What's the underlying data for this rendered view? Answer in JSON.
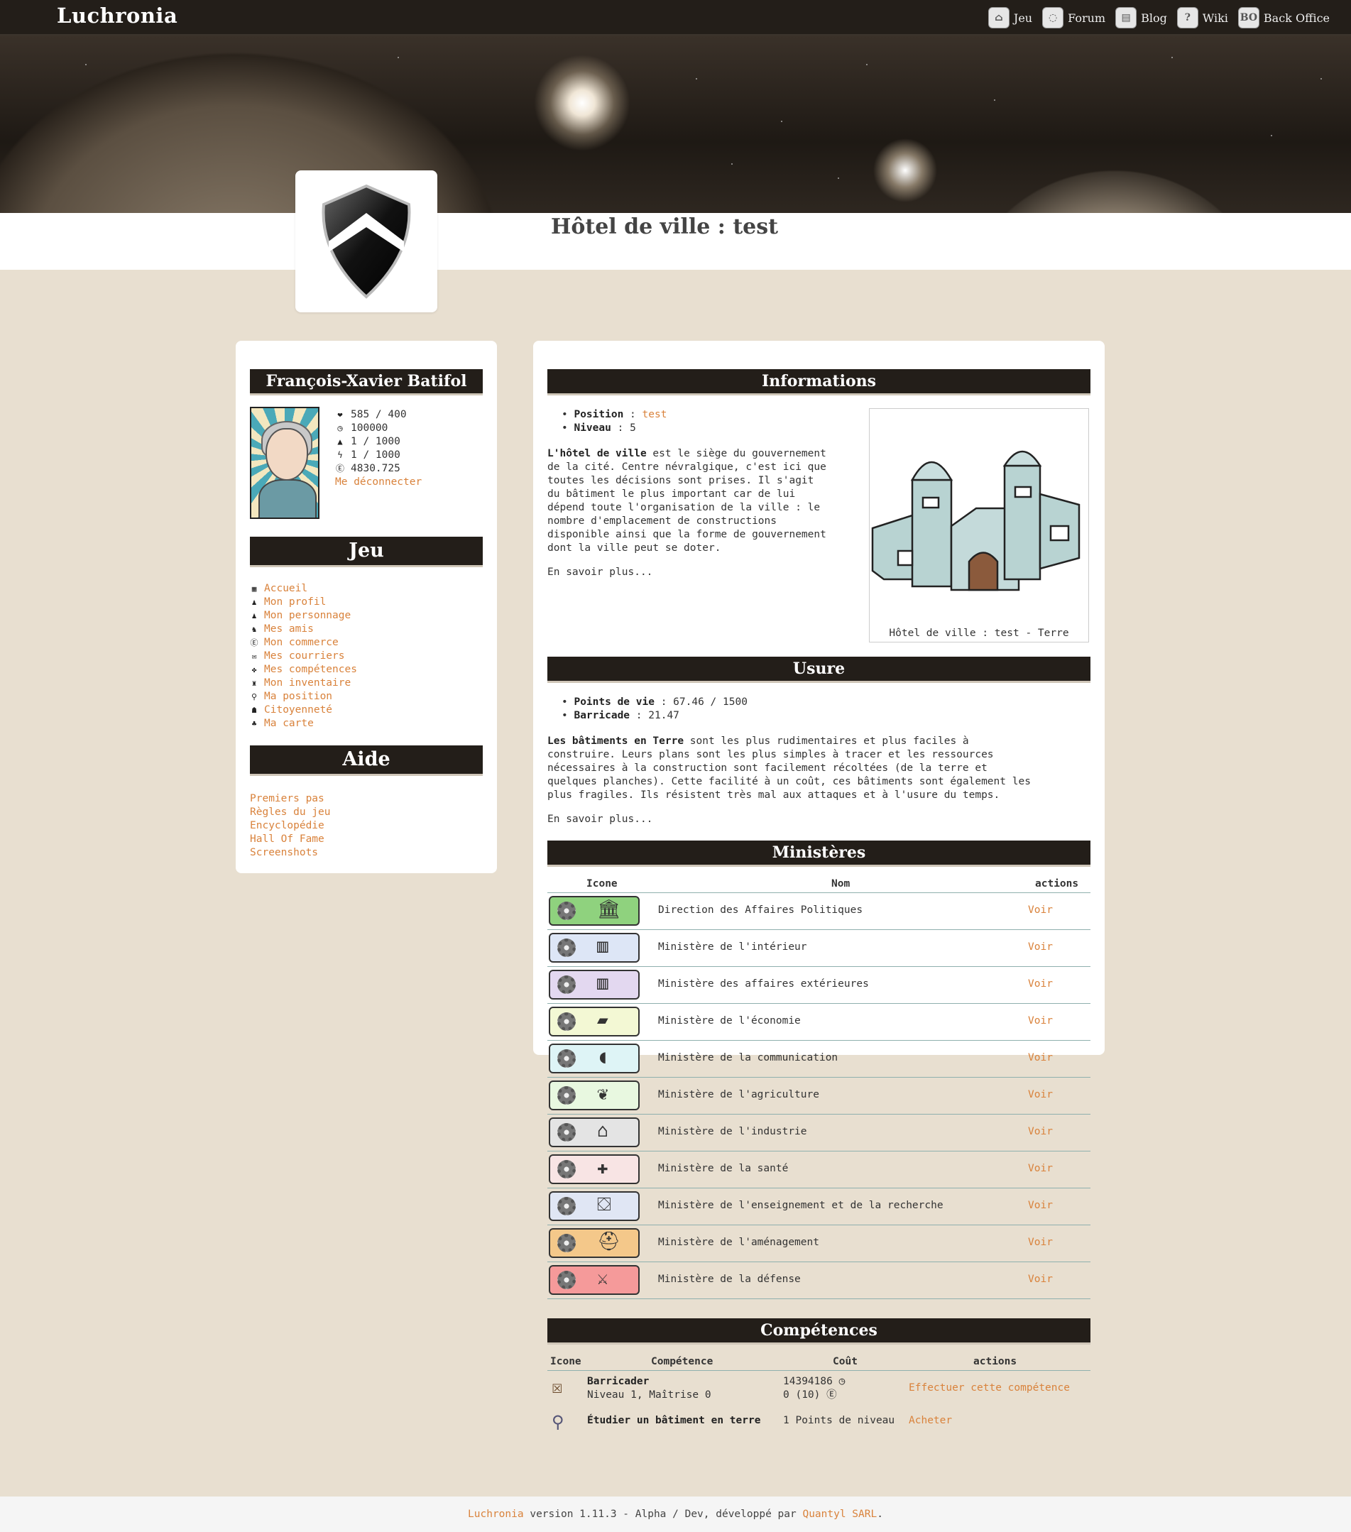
{
  "app": {
    "logo": "Luchronia",
    "nav": [
      {
        "label": "Jeu",
        "icon": "home-icon"
      },
      {
        "label": "Forum",
        "icon": "chat-bubble-icon"
      },
      {
        "label": "Blog",
        "icon": "book-icon"
      },
      {
        "label": "Wiki",
        "icon": "help-icon"
      },
      {
        "label": "Back Office",
        "icon": "bo-icon",
        "glyph": "BO"
      }
    ]
  },
  "page": {
    "title": "Hôtel de ville : test",
    "emblem_icon": "shield-chevron-icon"
  },
  "character": {
    "name": "François-Xavier Batifol",
    "stats": [
      {
        "icon": "heart-icon",
        "glyph": "❤",
        "value": "585 / 400"
      },
      {
        "icon": "clock-icon",
        "glyph": "◷",
        "value": "100000"
      },
      {
        "icon": "water-drop-icon",
        "glyph": "▲",
        "value": "1 / 1000"
      },
      {
        "icon": "lightning-icon",
        "glyph": "ϟ",
        "value": "1 / 1000"
      },
      {
        "icon": "money-icon",
        "glyph": "Ⓔ",
        "value": "4830.725"
      }
    ],
    "logout": "Me déconnecter"
  },
  "jeu": {
    "header": "Jeu",
    "items": [
      {
        "label": "Accueil",
        "icon": "grid-icon",
        "glyph": "▦"
      },
      {
        "label": "Mon profil",
        "icon": "user-icon",
        "glyph": "♟"
      },
      {
        "label": "Mon personnage",
        "icon": "user-icon",
        "glyph": "♟"
      },
      {
        "label": "Mes amis",
        "icon": "friends-icon",
        "glyph": "♞"
      },
      {
        "label": "Mon commerce",
        "icon": "money-icon",
        "glyph": "Ⓔ"
      },
      {
        "label": "Mes courriers",
        "icon": "mail-icon",
        "glyph": "✉"
      },
      {
        "label": "Mes compétences",
        "icon": "skills-icon",
        "glyph": "✤"
      },
      {
        "label": "Mon inventaire",
        "icon": "bag-icon",
        "glyph": "♜"
      },
      {
        "label": "Ma position",
        "icon": "pin-icon",
        "glyph": "⚲"
      },
      {
        "label": "Citoyenneté",
        "icon": "citizen-icon",
        "glyph": "☗"
      },
      {
        "label": "Ma carte",
        "icon": "map-icon",
        "glyph": "♣"
      }
    ]
  },
  "aide": {
    "header": "Aide",
    "items": [
      "Premiers pas",
      "Règles du jeu",
      "Encyclopédie",
      "Hall Of Fame",
      "Screenshots"
    ]
  },
  "informations": {
    "header": "Informations",
    "position_label": "Position",
    "position_value": "test",
    "niveau_label": "Niveau",
    "niveau_value": "5",
    "desc_bold": "L'hôtel de ville",
    "desc_lines": [
      "est le siège du gouvernement",
      "de la cité. Centre névralgique, c'est ici que",
      "toutes les décisions sont prises. Il s'agit",
      "du bâtiment le plus important car de lui",
      "dépend toute l'organisation de la ville : le",
      "nombre d'emplacement de constructions",
      "disponible ainsi que la forme de gouvernement",
      "dont la ville peut se doter."
    ],
    "more": "En savoir plus...",
    "image_caption": "Hôtel de ville : test - Terre",
    "image_icon": "city-hall-building-icon"
  },
  "usure": {
    "header": "Usure",
    "pv_label": "Points de vie",
    "pv_value": "67.46 / 1500",
    "barricade_label": "Barricade",
    "barricade_value": "21.47",
    "desc_bold": "Les bâtiments en Terre",
    "desc_lines": [
      "sont les plus rudimentaires et plus faciles à",
      "construire. Leurs plans sont les plus simples à tracer et les ressources",
      "nécessaires à la construction sont facilement récoltées (de la terre et",
      "quelques planches). Cette facilité à un coût, ces bâtiments sont également les",
      "plus fragiles. Ils résistent très mal aux attaques et à l'usure du temps."
    ],
    "more": "En savoir plus..."
  },
  "ministeres": {
    "header": "Ministères",
    "columns": [
      "Icone",
      "Nom",
      "actions"
    ],
    "rows": [
      {
        "name": "Direction des Affaires Politiques",
        "action": "Voir",
        "color": "#8fd27e",
        "icon": "politics-icon",
        "glyph": "🏛"
      },
      {
        "name": "Ministère de l'intérieur",
        "action": "Voir",
        "color": "#dde6f6",
        "icon": "interior-icon",
        "glyph": "▥"
      },
      {
        "name": "Ministère des affaires extérieures",
        "action": "Voir",
        "color": "#e3d8f0",
        "icon": "foreign-affairs-icon",
        "glyph": "▥"
      },
      {
        "name": "Ministère de l'économie",
        "action": "Voir",
        "color": "#f3f8d4",
        "icon": "economy-icon",
        "glyph": "▰"
      },
      {
        "name": "Ministère de la communication",
        "action": "Voir",
        "color": "#def4f6",
        "icon": "communication-icon",
        "glyph": "◖"
      },
      {
        "name": "Ministère de l'agriculture",
        "action": "Voir",
        "color": "#e8f8e0",
        "icon": "agriculture-icon",
        "glyph": "❦"
      },
      {
        "name": "Ministère de l'industrie",
        "action": "Voir",
        "color": "#e4e4e4",
        "icon": "industry-icon",
        "glyph": "⌂"
      },
      {
        "name": "Ministère de la santé",
        "action": "Voir",
        "color": "#f8e4e4",
        "icon": "health-icon",
        "glyph": "✚"
      },
      {
        "name": "Ministère de l'enseignement et de la recherche",
        "action": "Voir",
        "color": "#e0e6f4",
        "icon": "education-icon",
        "glyph": "⛋"
      },
      {
        "name": "Ministère de l'aménagement",
        "action": "Voir",
        "color": "#f4c88a",
        "icon": "planning-icon",
        "glyph": "⛑"
      },
      {
        "name": "Ministère de la défense",
        "action": "Voir",
        "color": "#f59a9a",
        "icon": "defense-icon",
        "glyph": "⚔"
      }
    ]
  },
  "competences": {
    "header": "Compétences",
    "columns": [
      "Icone",
      "Compétence",
      "Coût",
      "actions"
    ],
    "row1": {
      "icon": "barricade-icon",
      "name": "Barricader",
      "sub": "Niveau 1, Maîtrise 0",
      "cost1": "14394186",
      "cost1_icon": "clock-icon",
      "cost2": "0 (10)",
      "cost2_icon": "money-icon",
      "action": "Effectuer cette compétence"
    },
    "row2": {
      "icon": "study-magnifier-icon",
      "name": "Étudier un bâtiment en terre",
      "cost": "1 Points de niveau",
      "action": "Acheter"
    }
  },
  "footer": {
    "link1": "Luchronia",
    "text1": "version 1.11.3 - Alpha / Dev, développé par",
    "link2": "Quantyl SARL",
    "text2": "."
  }
}
